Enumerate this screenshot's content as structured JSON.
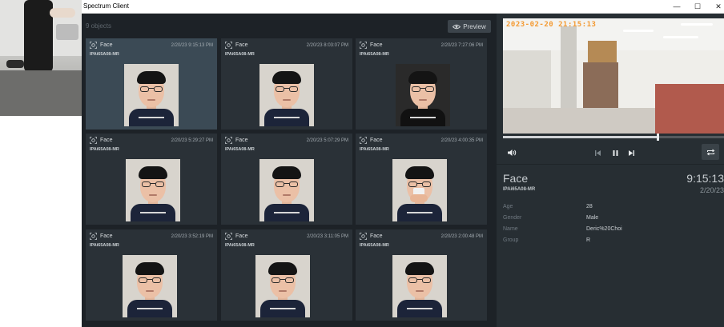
{
  "window": {
    "title": "Spectrum Client",
    "min_glyph": "—",
    "max_glyph": "☐",
    "close_glyph": "✕"
  },
  "toolbar": {
    "object_count": "9 objects",
    "preview_label": "Preview"
  },
  "cards": [
    {
      "type": "Face",
      "time": "2/20/23 9:15:13 PM",
      "camera": "IPAi65A08-MR",
      "selected": true
    },
    {
      "type": "Face",
      "time": "2/20/23 8:03:07 PM",
      "camera": "IPAi65A08-MR",
      "selected": false
    },
    {
      "type": "Face",
      "time": "2/20/23 7:27:06 PM",
      "camera": "IPAi65A08-MR",
      "selected": false
    },
    {
      "type": "Face",
      "time": "2/20/23 5:29:27 PM",
      "camera": "IPAi65A08-MR",
      "selected": false
    },
    {
      "type": "Face",
      "time": "2/20/23 5:07:29 PM",
      "camera": "IPAi65A08-MR",
      "selected": false
    },
    {
      "type": "Face",
      "time": "2/20/23 4:00:35 PM",
      "camera": "IPAi65A08-MR",
      "selected": false
    },
    {
      "type": "Face",
      "time": "2/20/23 3:52:19 PM",
      "camera": "IPAi65A08-MR",
      "selected": false
    },
    {
      "type": "Face",
      "time": "2/20/23 3:11:05 PM",
      "camera": "IPAi65A08-MR",
      "selected": false
    },
    {
      "type": "Face",
      "time": "2/20/23 2:00:48 PM",
      "camera": "IPAi65A08-MR",
      "selected": false
    }
  ],
  "player": {
    "osd_timestamp": "2023-02-20 21:15:13",
    "progress": 0.7,
    "icons": [
      "volume-icon",
      "skip-back-icon",
      "pause-icon",
      "skip-forward-icon",
      "repeat-icon"
    ]
  },
  "detail": {
    "type": "Face",
    "time": "9:15:13",
    "camera": "IPAi65A08-MR",
    "date": "2/20/23",
    "attributes": [
      {
        "label": "Age",
        "value": "28"
      },
      {
        "label": "Gender",
        "value": "Male"
      },
      {
        "label": "Name",
        "value": "Deric%20Choi"
      },
      {
        "label": "Group",
        "value": "R"
      }
    ]
  },
  "colors": {
    "app_background": "#1d2227",
    "card_background": "#2a3137",
    "card_selected": "#3b4a55",
    "osd_text": "#f49a32"
  }
}
